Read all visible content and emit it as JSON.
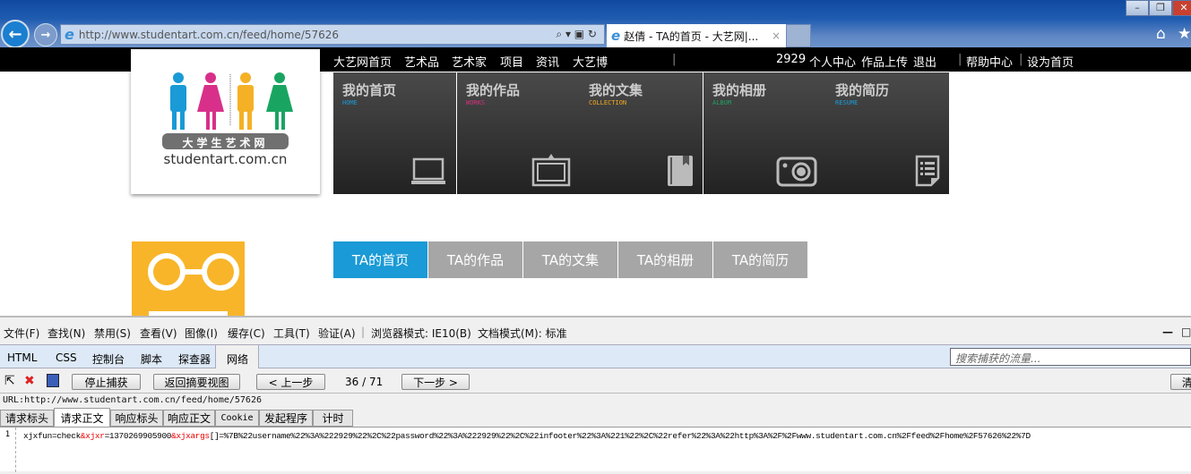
{
  "browser": {
    "url": "http://www.studentart.com.cn/feed/home/57626",
    "tab_title": "赵倩 - TA的首页 - 大艺网|...",
    "tab_close": "×",
    "win_min": "–",
    "win_max": "❐",
    "win_close": "✕"
  },
  "topnav": {
    "items": [
      "大艺网首页",
      "艺术品",
      "艺术家",
      "项目",
      "资讯",
      "大艺博"
    ],
    "user_id": "2929",
    "user_links": [
      "个人中心",
      "作品上传",
      "退出"
    ],
    "help": "帮助中心",
    "set_home": "设为首页"
  },
  "logo": {
    "cn": "大学生艺术网",
    "domain": "studentart.com.cn"
  },
  "tiles": [
    {
      "title": "我的首页",
      "sub": "HOME",
      "color": "#1a9ad6",
      "icon": "laptop-icon"
    },
    {
      "title": "我的作品",
      "sub": "WORKS",
      "color": "#d8307e",
      "icon": "picture-frame-icon"
    },
    {
      "title": "我的文集",
      "sub": "COLLECTION",
      "color": "#f0a820",
      "icon": "book-icon"
    },
    {
      "title": "我的相册",
      "sub": "ALBUM",
      "color": "#1ea060",
      "icon": "camera-icon"
    },
    {
      "title": "我的简历",
      "sub": "RESUME",
      "color": "#1a9ad6",
      "icon": "document-icon"
    }
  ],
  "profile_tabs": [
    "TA的首页",
    "TA的作品",
    "TA的文集",
    "TA的相册",
    "TA的简历"
  ],
  "devtools": {
    "menu": [
      "文件(F)",
      "查找(N)",
      "禁用(S)",
      "查看(V)",
      "图像(I)",
      "缓存(C)",
      "工具(T)",
      "验证(A)"
    ],
    "browser_mode": "浏览器模式: IE10(B)",
    "doc_mode": "文档模式(M): 标准",
    "tabs": [
      "HTML",
      "CSS",
      "控制台",
      "脚本",
      "探查器",
      "网络"
    ],
    "search_placeholder": "搜索捕获的流量...",
    "stop": "停止捕获",
    "back_summary": "返回摘要视图",
    "prev": "< 上一步",
    "counter": "36 / 71",
    "next": "下一步 >",
    "clear": "清",
    "url_line": "URL:http://www.studentart.com.cn/feed/home/57626",
    "subtabs": [
      "请求标头",
      "请求正文",
      "响应标头",
      "响应正文",
      "Cookie",
      "发起程序",
      "计时"
    ],
    "line_no": "1",
    "body": {
      "p1": "xjxfun=check",
      "p2": "&xjxr",
      "p3": "=1370269905900",
      "p4": "&xjxargs",
      "p5": "[]=%7B%22username%22%3A%222929%22%2C%22password%22%3A%222929%22%2C%22infooter%22%3A%221%22%2C%22refer%22%3A%22http%3A%2F%2Fwww.studentart.com.cn%2Ffeed%2Fhome%2F57626%22%7D"
    }
  }
}
